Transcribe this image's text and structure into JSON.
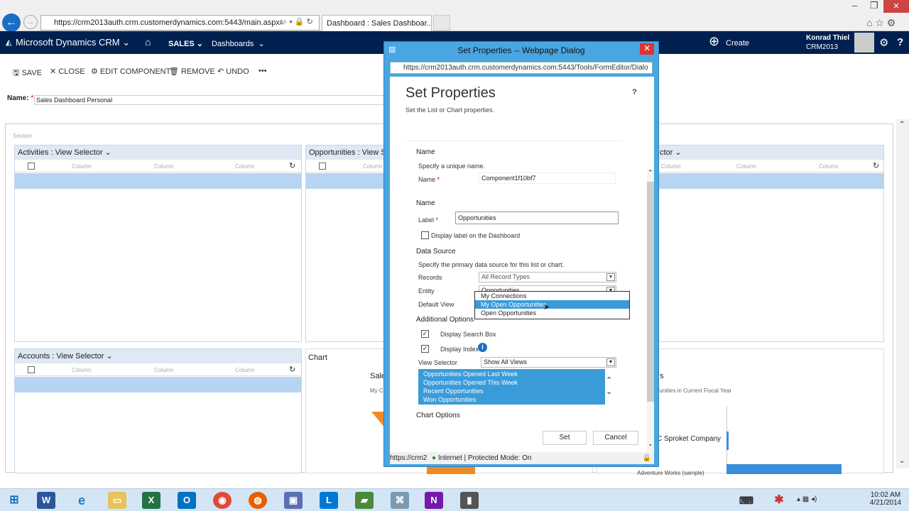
{
  "browser": {
    "address": "https://crm2013auth.crm.customerdynamics.com:5443/main.aspx#933369",
    "tab_title": "Dashboard : Sales Dashboar...",
    "controls": {
      "minimize": "–",
      "maximize": "❐",
      "close": "✕"
    }
  },
  "crm_nav": {
    "brand": "Microsoft Dynamics CRM",
    "area": "SALES",
    "section": "Dashboards",
    "create": "Create",
    "user_name": "Konrad Thiel",
    "org": "CRM2013"
  },
  "command_bar": {
    "save": "SAVE",
    "close": "CLOSE",
    "edit_component": "EDIT COMPONENT",
    "remove": "REMOVE",
    "undo": "UNDO",
    "more": "•••"
  },
  "form": {
    "name_label": "Name:",
    "name_value": "Sales Dashboard Personal",
    "section_label": "Section"
  },
  "panels": {
    "activities": "Activities : View Selector",
    "opportunities": "Opportunities : View S",
    "third": "ctor",
    "accounts": "Accounts : View Selector",
    "chart": "Chart",
    "column": "Column",
    "chart_sale": "Sale",
    "chart_myc": "My C",
    "chart_right_title": "s",
    "chart_right_sub": "ortunities in Current Fiscal Year",
    "chart_company": "C Sproket Company",
    "chart_adventure": "Adventure Works (sample)"
  },
  "dialog": {
    "window_title": "Set Properties -- Webpage Dialog",
    "url": "https://crm2013auth.crm.customerdynamics.com:5443/Tools/FormEditor/Dialo",
    "heading": "Set Properties",
    "subheading": "Set the List or Chart properties.",
    "help": "?",
    "name_section": "Name",
    "name_hint": "Specify a unique name.",
    "name_label": "Name",
    "name_value": "Component1f10bf7",
    "label_section": "Name",
    "label_label": "Label",
    "label_value": "Opportunities",
    "display_label_text": "Display label on the Dashboard",
    "data_source_section": "Data Source",
    "data_source_hint": "Specify the primary data source for this list or chart.",
    "records_label": "Records",
    "records_value": "All Record Types",
    "entity_label": "Entity",
    "entity_value": "Opportunities",
    "default_view_label": "Default View",
    "dropdown_options": [
      "My Connections",
      "My Open Opportunities",
      "Open Opportunities"
    ],
    "dropdown_selected": "My Open Opportunities",
    "additional_section": "Additional Options",
    "display_search": "Display Search Box",
    "display_index": "Display Index",
    "view_selector_label": "View Selector",
    "view_selector_value": "Show All Views",
    "views": [
      "Opportunities Opened Last Week",
      "Opportunities Opened This Week",
      "Recent Opportunities",
      "Won Opportunities"
    ],
    "chart_options_section": "Chart Options",
    "set_button": "Set",
    "cancel_button": "Cancel",
    "status_url": "https://crm2",
    "status_zone": "Internet | Protected Mode: On"
  },
  "taskbar": {
    "time": "10:02 AM",
    "date": "4/21/2014"
  }
}
